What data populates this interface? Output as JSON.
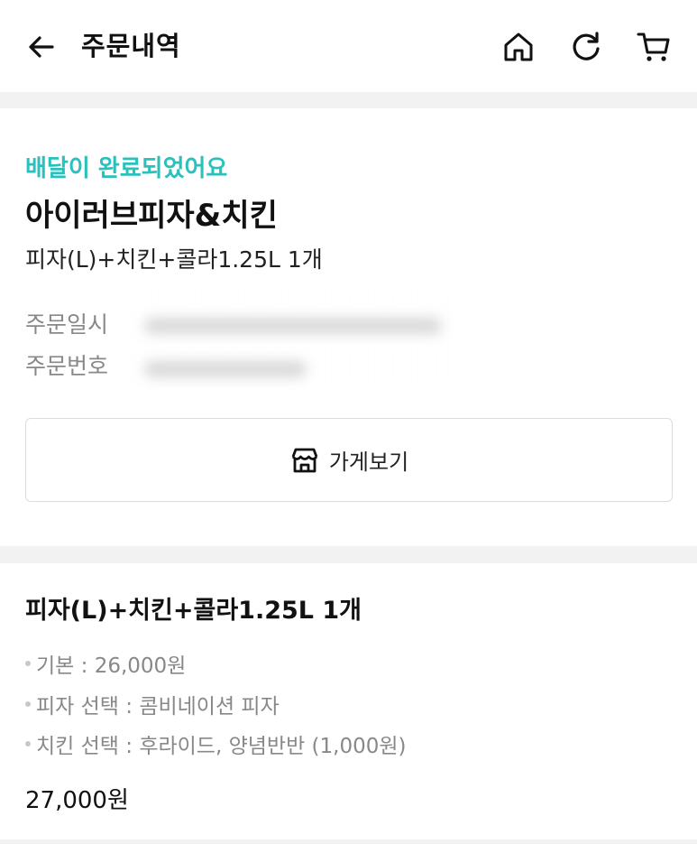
{
  "header": {
    "title": "주문내역",
    "icons": {
      "back": "arrow-left-icon",
      "home": "home-icon",
      "refresh": "refresh-icon",
      "cart": "cart-icon"
    }
  },
  "order": {
    "status": "배달이 완료되었어요",
    "status_color": "#2ac1bc",
    "store_name": "아이러브피자&치킨",
    "summary": "피자(L)+치킨+콜라1.25L 1개",
    "date_label": "주문일시",
    "number_label": "주문번호",
    "store_button_label": "가게보기",
    "store_icon": "store-icon"
  },
  "item": {
    "title": "피자(L)+치킨+콜라1.25L 1개",
    "options": [
      "기본 : 26,000원",
      "피자 선택 : 콤비네이션 피자",
      "치킨 선택 : 후라이드, 양념반반 (1,000원)"
    ],
    "total": "27,000원"
  }
}
